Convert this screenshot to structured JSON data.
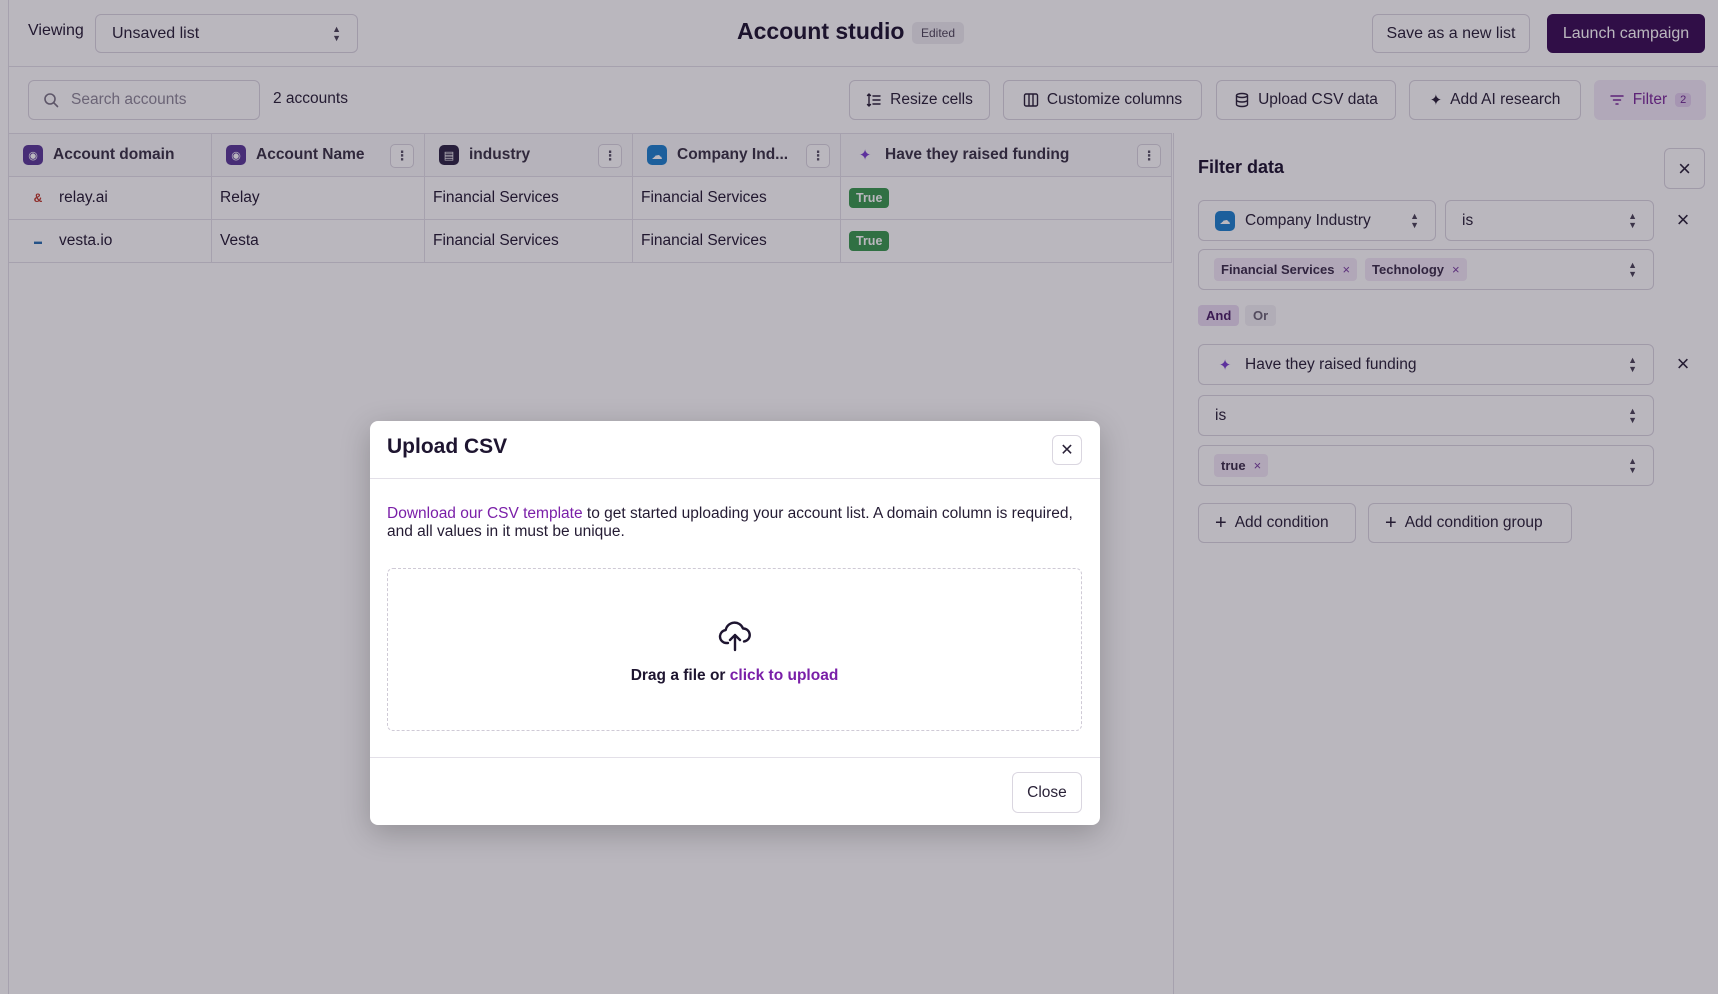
{
  "header": {
    "viewing_label": "Viewing",
    "list_select_value": "Unsaved list",
    "title": "Account studio",
    "edited_badge": "Edited",
    "save_label": "Save as a new list",
    "launch_label": "Launch campaign"
  },
  "toolbar": {
    "search_placeholder": "Search accounts",
    "count": "2 accounts",
    "resize_label": "Resize cells",
    "customize_label": "Customize columns",
    "upload_label": "Upload CSV data",
    "ai_label": "Add AI research",
    "filter_label": "Filter",
    "filter_count": "2"
  },
  "table": {
    "columns": [
      "Account domain",
      "Account Name",
      "industry",
      "Company Ind...",
      "Have they raised funding"
    ],
    "rows": [
      {
        "domain": "relay.ai",
        "name": "Relay",
        "industry": "Financial Services",
        "company_industry": "Financial Services",
        "funding": "True"
      },
      {
        "domain": "vesta.io",
        "name": "Vesta",
        "industry": "Financial Services",
        "company_industry": "Financial Services",
        "funding": "True"
      }
    ]
  },
  "filter_panel": {
    "title": "Filter data",
    "condition1": {
      "field": "Company Industry",
      "operator": "is",
      "values": [
        "Financial Services",
        "Technology"
      ]
    },
    "and_label": "And",
    "or_label": "Or",
    "condition2": {
      "field": "Have they raised funding",
      "operator": "is",
      "values": [
        "true"
      ]
    },
    "add_condition_label": "Add condition",
    "add_group_label": "Add condition group"
  },
  "modal": {
    "title": "Upload CSV",
    "desc_link": "Download our CSV template",
    "desc_rest": " to get started uploading your account list. A domain column is required, and all values in it must be unique.",
    "drop_prefix": "Drag a file or ",
    "drop_link": "click to upload",
    "close_label": "Close"
  },
  "colors": {
    "brand": "#3a0d55",
    "accent": "#7a1fa8",
    "true_badge": "#3a9a4f"
  }
}
